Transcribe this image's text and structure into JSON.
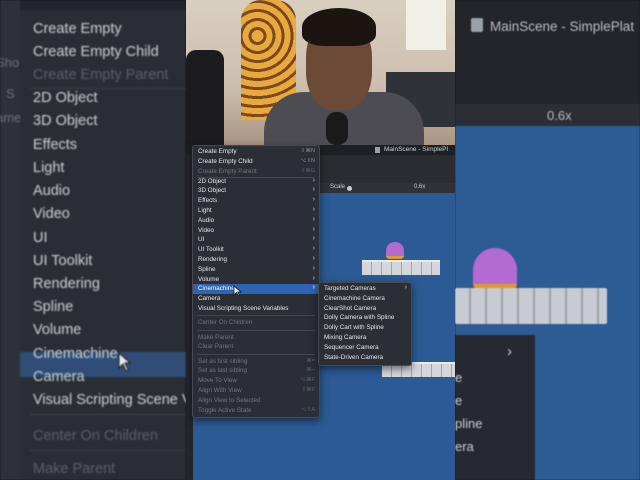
{
  "menu": {
    "items": [
      {
        "label": "Create Empty",
        "shortcut": "⇧⌘N",
        "enabled": true
      },
      {
        "label": "Create Empty Child",
        "shortcut": "⌥⇧N",
        "enabled": true
      },
      {
        "label": "Create Empty Parent",
        "shortcut": "⇧⌘G",
        "enabled": false
      },
      {
        "label": "2D Object",
        "submenu": true,
        "enabled": true
      },
      {
        "label": "3D Object",
        "submenu": true,
        "enabled": true
      },
      {
        "label": "Effects",
        "submenu": true,
        "enabled": true
      },
      {
        "label": "Light",
        "submenu": true,
        "enabled": true
      },
      {
        "label": "Audio",
        "submenu": true,
        "enabled": true
      },
      {
        "label": "Video",
        "submenu": true,
        "enabled": true
      },
      {
        "label": "UI",
        "submenu": true,
        "enabled": true
      },
      {
        "label": "UI Toolkit",
        "submenu": true,
        "enabled": true
      },
      {
        "label": "Rendering",
        "submenu": true,
        "enabled": true
      },
      {
        "label": "Spline",
        "submenu": true,
        "enabled": true
      },
      {
        "label": "Volume",
        "submenu": true,
        "enabled": true
      },
      {
        "label": "Cinemachine",
        "submenu": true,
        "enabled": true,
        "highlighted": true
      },
      {
        "label": "Camera",
        "enabled": true
      },
      {
        "label": "Visual Scripting Scene Variables",
        "enabled": true
      },
      {
        "label": "Center On Children",
        "enabled": false
      },
      {
        "label": "Make Parent",
        "enabled": false
      },
      {
        "label": "Clear Parent",
        "enabled": false
      },
      {
        "label": "Set as first sibling",
        "shortcut": "⌘=",
        "enabled": false
      },
      {
        "label": "Set as last sibling",
        "shortcut": "⌘−",
        "enabled": false
      },
      {
        "label": "Move To View",
        "shortcut": "⌥⌘F",
        "enabled": false
      },
      {
        "label": "Align With View",
        "shortcut": "⇧⌘F",
        "enabled": false
      },
      {
        "label": "Align View to Selected",
        "enabled": false
      },
      {
        "label": "Toggle Active State",
        "shortcut": "⌥⇧A",
        "enabled": false
      }
    ]
  },
  "submenu": {
    "items": [
      {
        "label": "Targeted Cameras",
        "submenu": true
      },
      {
        "label": "Cinemachine Camera"
      },
      {
        "label": "ClearShot Camera"
      },
      {
        "label": "Dolly Camera with Spline"
      },
      {
        "label": "Dolly Cart with Spline"
      },
      {
        "label": "Mixing Camera"
      },
      {
        "label": "Sequencer Camera"
      },
      {
        "label": "State-Driven Camera"
      }
    ]
  },
  "editor": {
    "scene_title": "MainScene - SimplePl",
    "scale_label": "Scale",
    "scale_value": "0.6x"
  },
  "background": {
    "scene_title": "MainScene - SimplePlat",
    "scale_value": "0.6x",
    "left_strip": [
      "Shore",
      "S",
      "ame"
    ],
    "right_fragments": [
      "e",
      "e",
      "pline",
      "era"
    ]
  },
  "colors": {
    "menu_bg": "#2b2e35",
    "highlight": "#2f64b3",
    "scene_bg": "#2b5a94"
  }
}
